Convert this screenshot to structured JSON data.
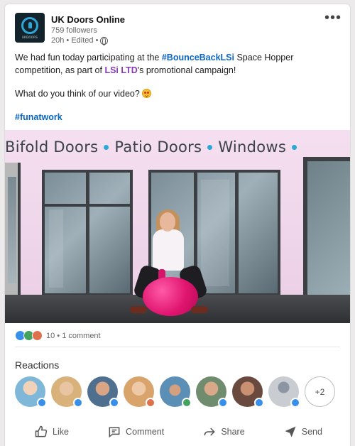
{
  "post": {
    "company": "UK Doors Online",
    "logo_text": "UKDOORS",
    "followers": "759 followers",
    "time": "20h • Edited •",
    "more_label": "•••",
    "text": {
      "line1_prefix": "We had fun today participating at the ",
      "hashtag1": "#BounceBackLSi",
      "line1_suffix": " Space Hopper competition, as part of ",
      "mention": "LSi LTD",
      "line1_end": "'s promotional campaign!",
      "line2": "What do you think of our video? ",
      "hashtag2": "#funatwork"
    }
  },
  "video": {
    "sign_words": [
      "Bifold Doors",
      "Patio Doors",
      "Windows"
    ]
  },
  "social": {
    "counts": "10 • 1 comment",
    "reaction_icons": [
      "like-icon",
      "celebrate-icon",
      "love-icon"
    ]
  },
  "reactions": {
    "title": "Reactions",
    "avatars": [
      {
        "color": "#7fb7d8",
        "badge": "like"
      },
      {
        "color": "#d8b27a",
        "badge": "like"
      },
      {
        "color": "#c98a6a",
        "badge": "like"
      },
      {
        "color": "#d9a46b",
        "badge": "love"
      },
      {
        "color": "#5c8fb5",
        "badge": "celebrate"
      },
      {
        "color": "#8aa07e",
        "badge": "like"
      },
      {
        "color": "#9b5f4a",
        "badge": "like"
      },
      {
        "color": "#c9ccd1",
        "badge": "like"
      }
    ],
    "more": "+2"
  },
  "actions": {
    "like": "Like",
    "comment": "Comment",
    "share": "Share",
    "send": "Send"
  },
  "colors": {
    "link_blue": "#0a66c2",
    "mention_purple": "#8a3ab9",
    "like_blue": "#378fe9",
    "space_hopper_pink": "#e0156f"
  }
}
